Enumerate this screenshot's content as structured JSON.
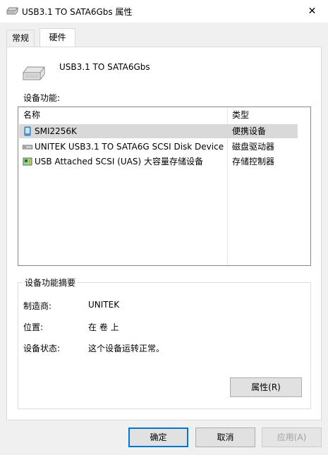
{
  "window": {
    "title": "USB3.1 TO SATA6Gbs 属性",
    "close_glyph": "✕"
  },
  "tabs": [
    {
      "label": "常规",
      "active": false
    },
    {
      "label": "硬件",
      "active": true
    }
  ],
  "device": {
    "name": "USB3.1 TO SATA6Gbs",
    "icon": "drive-icon"
  },
  "functions": {
    "label": "设备功能:",
    "columns": {
      "name": "名称",
      "type": "类型"
    },
    "rows": [
      {
        "name": "SMI2256K",
        "type": "便携设备",
        "icon": "portable-device-icon",
        "selected": true
      },
      {
        "name": "UNITEK USB3.1 TO SATA6G SCSI Disk Device",
        "type": "磁盘驱动器",
        "icon": "disk-drive-icon",
        "selected": false
      },
      {
        "name": "USB Attached SCSI (UAS) 大容量存储设备",
        "type": "存储控制器",
        "icon": "storage-controller-icon",
        "selected": false
      }
    ]
  },
  "summary": {
    "title": "设备功能摘要",
    "manufacturer_label": "制造商:",
    "manufacturer_value": "UNITEK",
    "location_label": "位置:",
    "location_value": "在 卷 上",
    "status_label": "设备状态:",
    "status_value": "这个设备运转正常。",
    "properties_button": "属性(R)"
  },
  "footer": {
    "ok": "确定",
    "cancel": "取消",
    "apply": "应用(A)"
  },
  "colors": {
    "accent": "#0078d7",
    "selected_row": "#d9d9d9"
  }
}
